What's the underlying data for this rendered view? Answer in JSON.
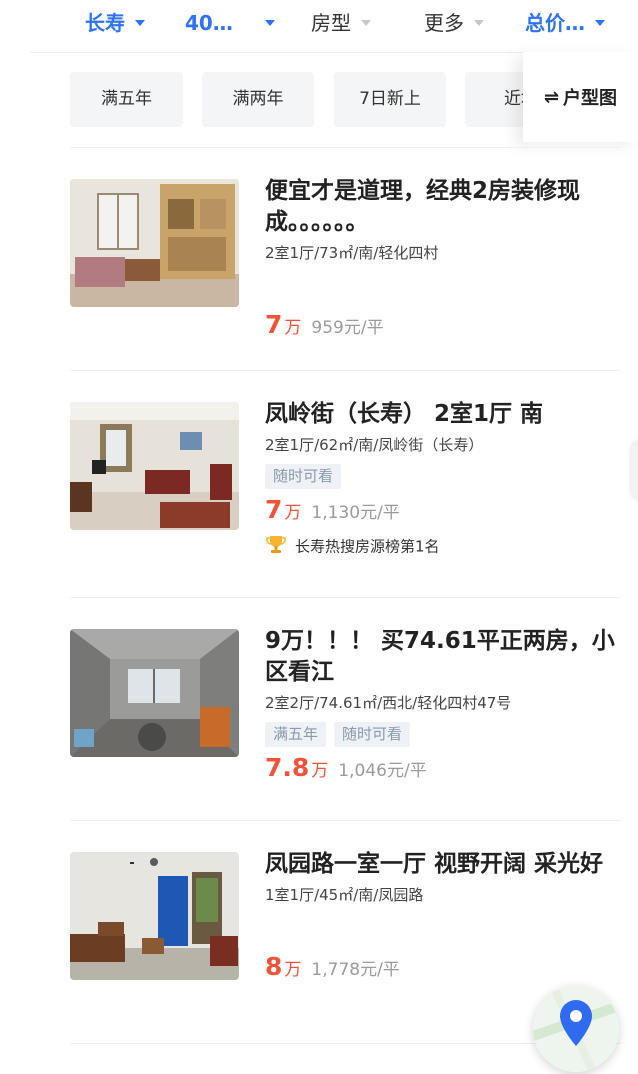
{
  "filters": [
    {
      "label": "长寿",
      "active": true
    },
    {
      "label": "40…",
      "active": true
    },
    {
      "label": "房型",
      "active": false
    },
    {
      "label": "更多",
      "active": false
    },
    {
      "label": "总价…",
      "active": true
    }
  ],
  "chips": [
    "满五年",
    "满两年",
    "7日新上",
    "近地"
  ],
  "layout_button": {
    "icon": "swap-arrows-icon",
    "label": "户型图"
  },
  "listings": [
    {
      "title": "便宜才是道理，经典2房装修现成。。。。。。",
      "meta": "2室1厅/73㎡/南/轻化四村",
      "tags": [],
      "price": "7",
      "price_unit": "万",
      "unit_price": "959元/平",
      "rank": ""
    },
    {
      "title": "凤岭街（长寿） 2室1厅 南",
      "meta": "2室1厅/62㎡/南/凤岭街（长寿）",
      "tags": [
        "随时可看"
      ],
      "price": "7",
      "price_unit": "万",
      "unit_price": "1,130元/平",
      "rank": "长寿热搜房源榜第1名"
    },
    {
      "title": "9万！！！ 买74.61平正两房，小区看江",
      "meta": "2室2厅/74.61㎡/西北/轻化四村47号",
      "tags": [
        "满五年",
        "随时可看"
      ],
      "price": "7.8",
      "price_unit": "万",
      "unit_price": "1,046元/平",
      "rank": ""
    },
    {
      "title": "凤园路一室一厅 视野开阔 采光好",
      "meta": "1室1厅/45㎡/南/凤园路",
      "tags": [],
      "price": "8",
      "price_unit": "万",
      "unit_price": "1,778元/平",
      "rank": ""
    }
  ],
  "map_button": {
    "icon": "location-pin-icon"
  },
  "colors": {
    "accent": "#3072f6",
    "price": "#f0533a",
    "tag_text": "#8a99ad",
    "tag_bg": "#eef1f5"
  }
}
